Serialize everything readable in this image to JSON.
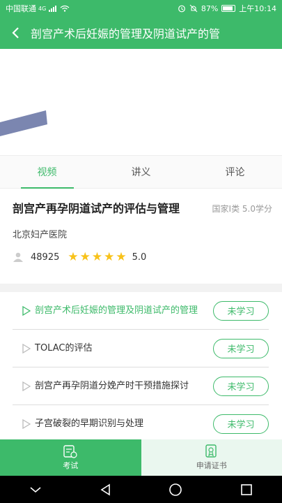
{
  "status_bar": {
    "carrier": "中国联通",
    "network": "4G",
    "battery": "87%",
    "battery_level": 0.87,
    "time": "上午10:14"
  },
  "header": {
    "title": "剖宫产术后妊娠的管理及阴道试产的管",
    "back_icon": "back-arrow-icon"
  },
  "tabs": [
    {
      "label": "视频",
      "active": true
    },
    {
      "label": "讲义",
      "active": false
    },
    {
      "label": "评论",
      "active": false
    }
  ],
  "course": {
    "title": "剖宫产再孕阴道试产的评估与管理",
    "meta": "国家I类 5.0学分",
    "hospital": "北京妇产医院",
    "views": "48925",
    "stars": 5,
    "rating": "5.0"
  },
  "lessons": [
    {
      "title": "剖宫产术后妊娠的管理及阴道试产的管理",
      "status": "未学习",
      "current": true
    },
    {
      "title": "TOLAC的评估",
      "status": "未学习",
      "current": false
    },
    {
      "title": "剖宫产再孕阴道分娩产时干预措施探讨",
      "status": "未学习",
      "current": false
    },
    {
      "title": "子宫破裂的早期识别与处理",
      "status": "未学习",
      "current": false
    }
  ],
  "bottom_bar": {
    "exam_label": "考试",
    "cert_label": "申请证书"
  },
  "colors": {
    "accent": "#3dba6a",
    "star": "#f8c21a"
  }
}
